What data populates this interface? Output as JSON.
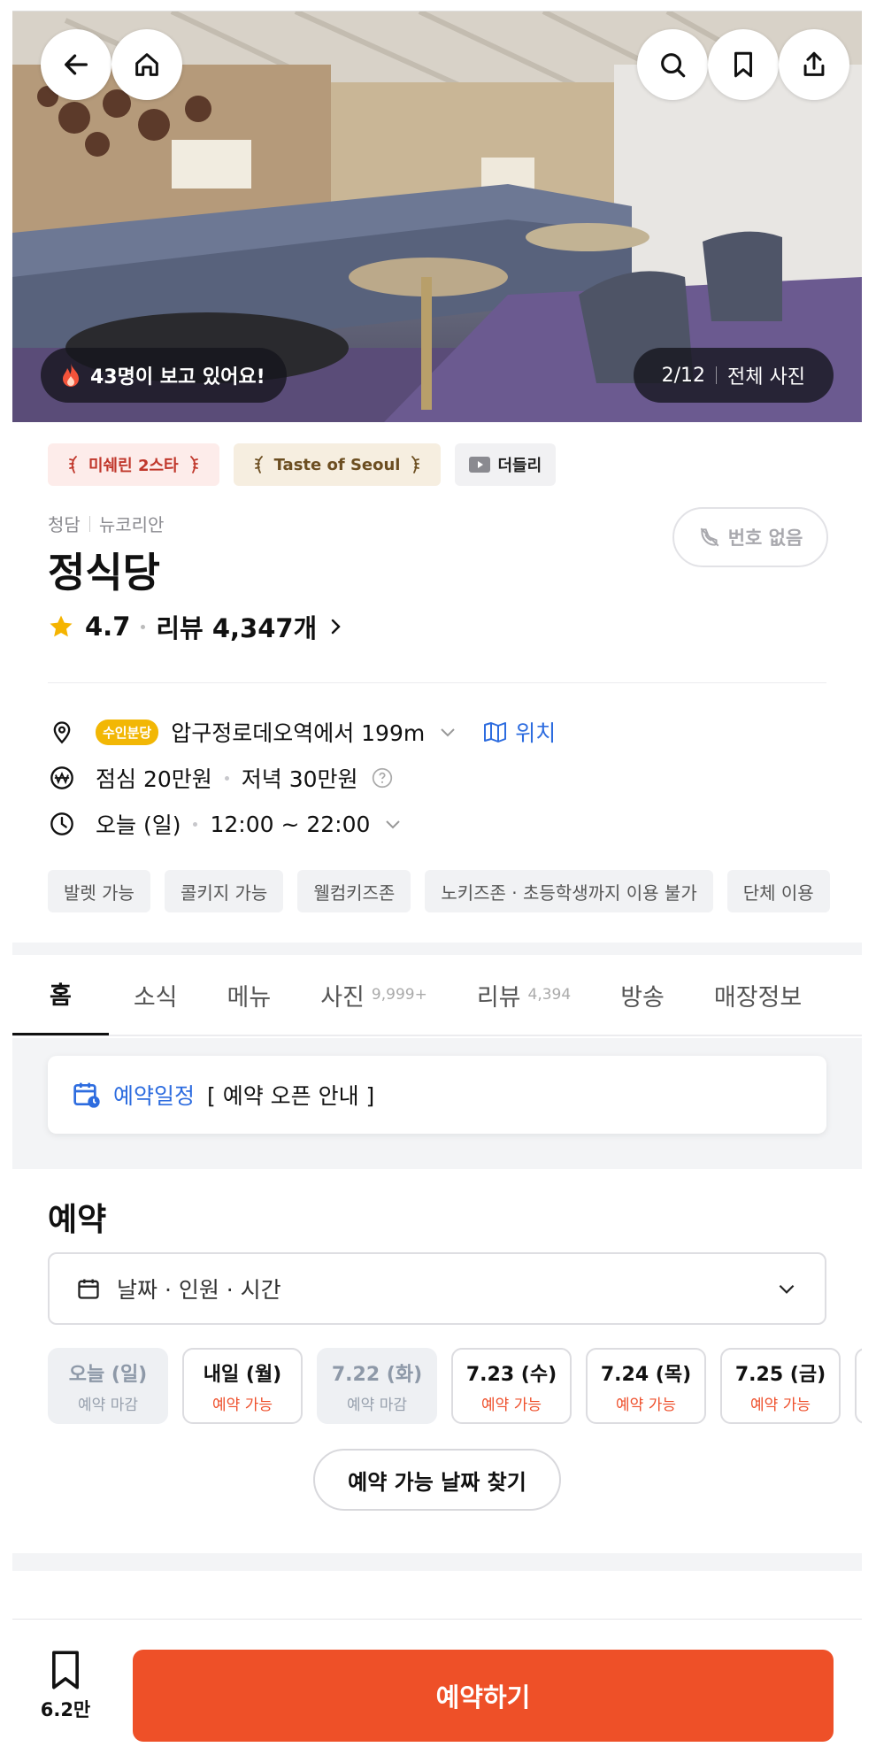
{
  "hero": {
    "viewers_text": "43명이 보고 있어요!",
    "photo_counter": "2/12",
    "all_photos": "전체 사진"
  },
  "badges": {
    "michelin": "미쉐린 2스타",
    "taste": "Taste of Seoul",
    "deuldeul": "더들리"
  },
  "restaurant": {
    "area": "청담",
    "cuisine": "뉴코리안",
    "name": "정식당",
    "rating": "4.7",
    "reviews": "리뷰 4,347개",
    "no_phone": "번호 없음"
  },
  "info": {
    "exit_badge": "수인분당",
    "distance": "압구정로데오역에서 199m",
    "location_link": "위치",
    "lunch": "점심 20만원",
    "dinner": "저녁 30만원",
    "today": "오늘 (일)",
    "hours": "12:00 ~ 22:00"
  },
  "chips": [
    "발렛 가능",
    "콜키지 가능",
    "웰컴키즈존",
    "노키즈존 · 초등학생까지 이용 불가",
    "단체 이용"
  ],
  "tabs": [
    {
      "label": "홈",
      "count": ""
    },
    {
      "label": "소식",
      "count": ""
    },
    {
      "label": "메뉴",
      "count": ""
    },
    {
      "label": "사진",
      "count": "9,999+"
    },
    {
      "label": "리뷰",
      "count": "4,394"
    },
    {
      "label": "방송",
      "count": ""
    },
    {
      "label": "매장정보",
      "count": ""
    }
  ],
  "notice": {
    "label": "예약일정",
    "text": "[ 예약 오픈 안내 ]"
  },
  "reservation": {
    "title": "예약",
    "picker": "날짜 · 인원 · 시간",
    "dates": [
      {
        "day": "오늘 (일)",
        "status": "예약 마감"
      },
      {
        "day": "내일 (월)",
        "status": "예약 가능"
      },
      {
        "day": "7.22 (화)",
        "status": "예약 마감"
      },
      {
        "day": "7.23 (수)",
        "status": "예약 가능"
      },
      {
        "day": "7.24 (목)",
        "status": "예약 가능"
      },
      {
        "day": "7.25 (금)",
        "status": "예약 가능"
      }
    ],
    "find_button": "예약 가능 날짜 찾기"
  },
  "bottom": {
    "save_count": "6.2만",
    "reserve_button": "예약하기"
  },
  "colors": {
    "accent": "#ee5028",
    "link": "#2d6cdf",
    "star": "#f5b400"
  }
}
